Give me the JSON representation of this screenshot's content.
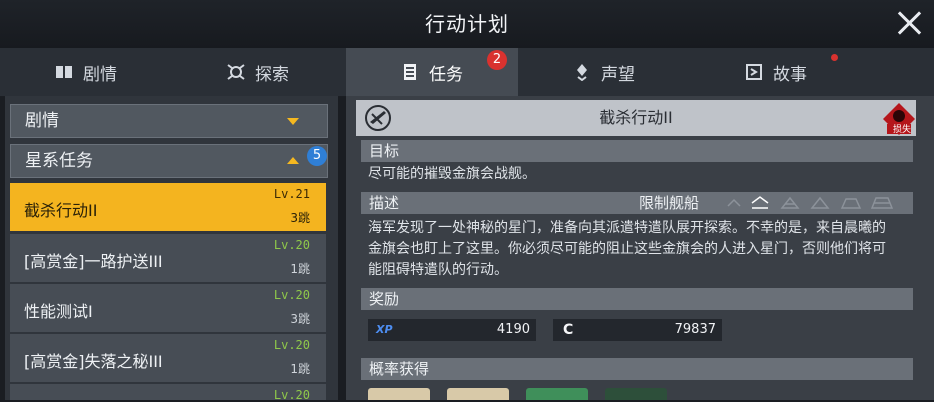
{
  "window": {
    "title": "行动计划"
  },
  "tabs": [
    {
      "label": "剧情",
      "icon": "book-icon"
    },
    {
      "label": "探索",
      "icon": "explore-icon"
    },
    {
      "label": "任务",
      "icon": "document-icon",
      "badge": "2"
    },
    {
      "label": "声望",
      "icon": "emblem-icon"
    },
    {
      "label": "故事",
      "icon": "story-icon"
    }
  ],
  "left": {
    "sections": [
      {
        "label": "剧情"
      },
      {
        "label": "星系任务",
        "badge": "5"
      }
    ],
    "missions": [
      {
        "name": "截杀行动II",
        "level": "Lv.21",
        "jumps": "3跳",
        "selected": true
      },
      {
        "name": "[高赏金]一路护送III",
        "level": "Lv.20",
        "jumps": "1跳"
      },
      {
        "name": "性能测试I",
        "level": "Lv.20",
        "jumps": "3跳"
      },
      {
        "name": "[高赏金]失落之秘III",
        "level": "Lv.20",
        "jumps": "1跳"
      },
      {
        "name": "",
        "level": "Lv.20",
        "jumps": ""
      }
    ]
  },
  "detail": {
    "title": "截杀行动II",
    "loss_label": "损失",
    "objective_label": "目标",
    "objective_text": "尽可能的摧毁金旗会战舰。",
    "desc_label": "描述",
    "restriction_label": "限制舰船",
    "desc_lines": [
      "海军发现了一处神秘的星门，准备向其派遣特遣队展开探索。不幸的是，来自晨曦的",
      "金旗会也盯上了这里。你必须尽可能的阻止这些金旗会的人进入星门，否则他们将可",
      "能阻碍特遣队的行动。"
    ],
    "reward_label": "奖励",
    "rewards": [
      {
        "tag": "XP",
        "value": "4190"
      },
      {
        "tag": "C",
        "value": "79837"
      }
    ],
    "drops_label": "概率获得"
  },
  "colors": {
    "accent": "#f4b41f",
    "badge_red": "#d9322f",
    "badge_blue": "#2f7fd6",
    "level_green": "#8fc84a"
  }
}
